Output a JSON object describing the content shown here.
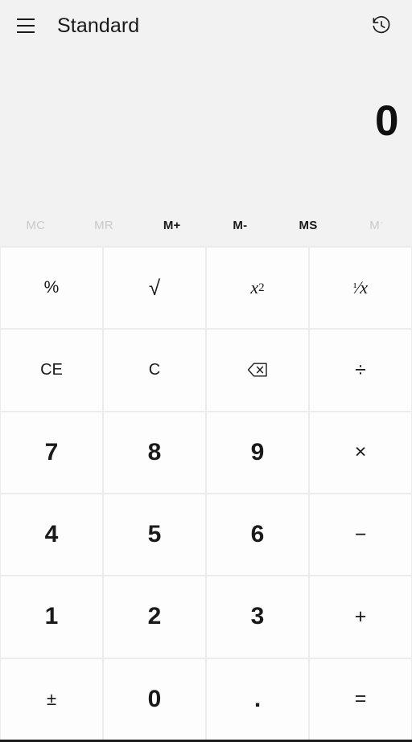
{
  "window": {
    "title": "Standard",
    "menu_icon": "hamburger-menu-icon",
    "history_icon": "history-clock-icon"
  },
  "display": {
    "expression": "",
    "value": "0"
  },
  "memory": {
    "buttons": [
      {
        "label": "MC",
        "name": "memory-clear",
        "enabled": false
      },
      {
        "label": "MR",
        "name": "memory-recall",
        "enabled": false
      },
      {
        "label": "M+",
        "name": "memory-add",
        "enabled": true
      },
      {
        "label": "M-",
        "name": "memory-subtract",
        "enabled": true
      },
      {
        "label": "MS",
        "name": "memory-store",
        "enabled": true
      },
      {
        "label": "M",
        "name": "memory-dropdown",
        "enabled": false,
        "caret": "ˇ"
      }
    ]
  },
  "keypad": {
    "percent": "%",
    "square_root": "√",
    "square": {
      "base": "x",
      "exponent": "2"
    },
    "reciprocal": {
      "numerator": "¹",
      "slash": "⁄",
      "denominator": "x"
    },
    "clear_entry": "CE",
    "clear": "C",
    "backspace": "backspace-icon",
    "divide": "÷",
    "seven": "7",
    "eight": "8",
    "nine": "9",
    "multiply": "×",
    "four": "4",
    "five": "5",
    "six": "6",
    "subtract": "−",
    "one": "1",
    "two": "2",
    "three": "3",
    "add": "+",
    "negate": "±",
    "zero": "0",
    "decimal": ".",
    "equals": "="
  },
  "colors": {
    "background": "#f2f2f2",
    "key_background": "#fdfdfd",
    "key_gap": "#ececec",
    "text": "#1a1a1a",
    "disabled_text": "#c9c9c9"
  }
}
